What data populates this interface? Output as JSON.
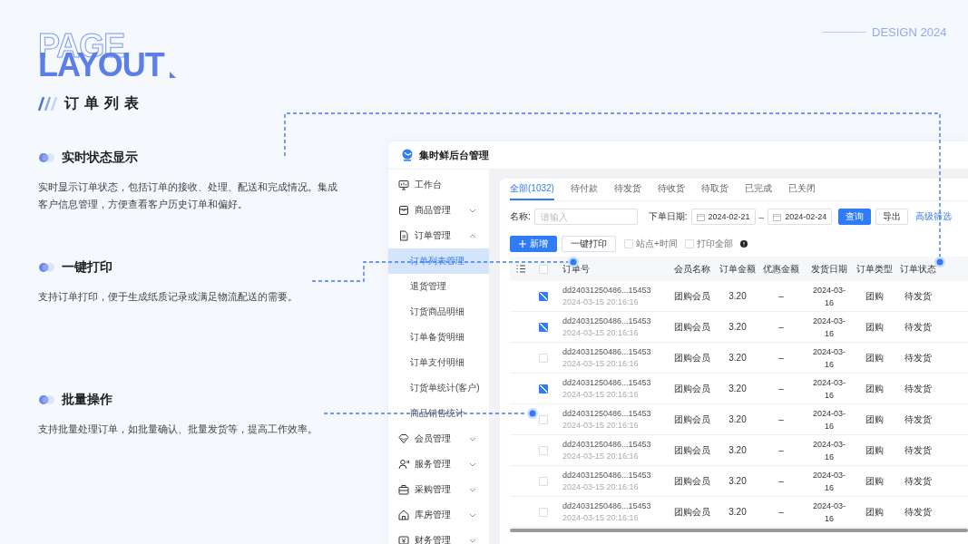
{
  "header": {
    "outline": "PAGE",
    "title": "LAYOUT",
    "subtitle": "订单列表",
    "tag": "DESIGN 2024"
  },
  "features": [
    {
      "title": "实时状态显示",
      "description": "实时显示订单状态，包括订单的接收、处理、配送和完成情况。集成客户信息管理，方便查看客户历史订单和偏好。"
    },
    {
      "title": "一键打印",
      "description": "支持订单打印，便于生成纸质记录或满足物流配送的需要。"
    },
    {
      "title": "批量操作",
      "description": "支持批量处理订单，如批量确认、批量发货等，提高工作效率。"
    }
  ],
  "app": {
    "title": "集时鲜后台管理",
    "sidebar": [
      {
        "label": "工作台",
        "selected": false
      },
      {
        "label": "商品管理",
        "selected": false,
        "expanded": false
      },
      {
        "label": "订单管理",
        "selected": false,
        "expanded": true,
        "children": [
          {
            "label": "订单列表管理",
            "selected": true
          },
          {
            "label": "退货管理",
            "selected": false
          },
          {
            "label": "订货商品明细",
            "selected": false
          },
          {
            "label": "订单备货明细",
            "selected": false
          },
          {
            "label": "订单支付明细",
            "selected": false
          },
          {
            "label": "订货单统计(客户)",
            "selected": false
          },
          {
            "label": "商品销售统计",
            "selected": false
          }
        ]
      },
      {
        "label": "会员管理",
        "selected": false,
        "expanded": false
      },
      {
        "label": "服务管理",
        "selected": false,
        "expanded": false
      },
      {
        "label": "采购管理",
        "selected": false,
        "expanded": false
      },
      {
        "label": "库房管理",
        "selected": false,
        "expanded": false
      },
      {
        "label": "财务管理",
        "selected": false,
        "expanded": false
      }
    ],
    "tabs": [
      {
        "label": "全部(1032)",
        "selected": true
      },
      {
        "label": "待付款",
        "selected": false
      },
      {
        "label": "待发货",
        "selected": false
      },
      {
        "label": "待收货",
        "selected": false
      },
      {
        "label": "待取货",
        "selected": false
      },
      {
        "label": "已完成",
        "selected": false
      },
      {
        "label": "已关闭",
        "selected": false
      }
    ],
    "filter": {
      "name_label": "名称:",
      "name_placeholder": "请输入",
      "date_label": "下单日期:",
      "date_start": "2024-02-21",
      "date_separator": "–",
      "date_end": "2024-02-24",
      "buttons": [
        {
          "label": "查询",
          "kind": "primary"
        },
        {
          "label": "导出",
          "kind": "default"
        }
      ],
      "link": "高级筛选"
    },
    "actions": {
      "buttons": [
        {
          "label": "新增",
          "kind": "primary"
        },
        {
          "label": "一键打印",
          "kind": "default"
        }
      ],
      "options": [
        {
          "label": "站点+时间",
          "checked": false
        },
        {
          "label": "打印全部",
          "checked": false
        }
      ]
    },
    "table": {
      "select_all": false,
      "columns": [
        "订单号",
        "会员名称",
        "订单金额",
        "优惠金额",
        "发货日期",
        "订单类型",
        "订单状态"
      ],
      "rows": [
        {
          "selected": true,
          "order_no": "dd24031250486...15453",
          "time": "2024-03-15 20:16:16",
          "member": "团购会员",
          "amount": "3.20",
          "discount": "–",
          "date": "2024-03-16",
          "type": "团购",
          "status": "待发货"
        },
        {
          "selected": true,
          "order_no": "dd24031250486...15453",
          "time": "2024-03-15 20:16:16",
          "member": "团购会员",
          "amount": "3.20",
          "discount": "–",
          "date": "2024-03-16",
          "type": "团购",
          "status": "待发货"
        },
        {
          "selected": false,
          "order_no": "dd24031250486...15453",
          "time": "2024-03-15 20:16:16",
          "member": "团购会员",
          "amount": "3.20",
          "discount": "–",
          "date": "2024-03-16",
          "type": "团购",
          "status": "待发货"
        },
        {
          "selected": true,
          "order_no": "dd24031250486...15453",
          "time": "2024-03-15 20:16:16",
          "member": "团购会员",
          "amount": "3.20",
          "discount": "–",
          "date": "2024-03-16",
          "type": "团购",
          "status": "待发货"
        },
        {
          "selected": false,
          "order_no": "dd24031250486...15453",
          "time": "2024-03-15 20:16:16",
          "member": "团购会员",
          "amount": "3.20",
          "discount": "–",
          "date": "2024-03-16",
          "type": "团购",
          "status": "待发货"
        },
        {
          "selected": false,
          "order_no": "dd24031250486...15453",
          "time": "2024-03-15 20:16:16",
          "member": "团购会员",
          "amount": "3.20",
          "discount": "–",
          "date": "2024-03-16",
          "type": "团购",
          "status": "待发货"
        },
        {
          "selected": false,
          "order_no": "dd24031250486...15453",
          "time": "2024-03-15 20:16:16",
          "member": "团购会员",
          "amount": "3.20",
          "discount": "–",
          "date": "2024-03-16",
          "type": "团购",
          "status": "待发货"
        },
        {
          "selected": false,
          "order_no": "dd24031250486...15453",
          "time": "2024-03-15 20:16:16",
          "member": "团购会员",
          "amount": "3.20",
          "discount": "–",
          "date": "2024-03-16",
          "type": "团购",
          "status": "待发货"
        }
      ]
    }
  }
}
